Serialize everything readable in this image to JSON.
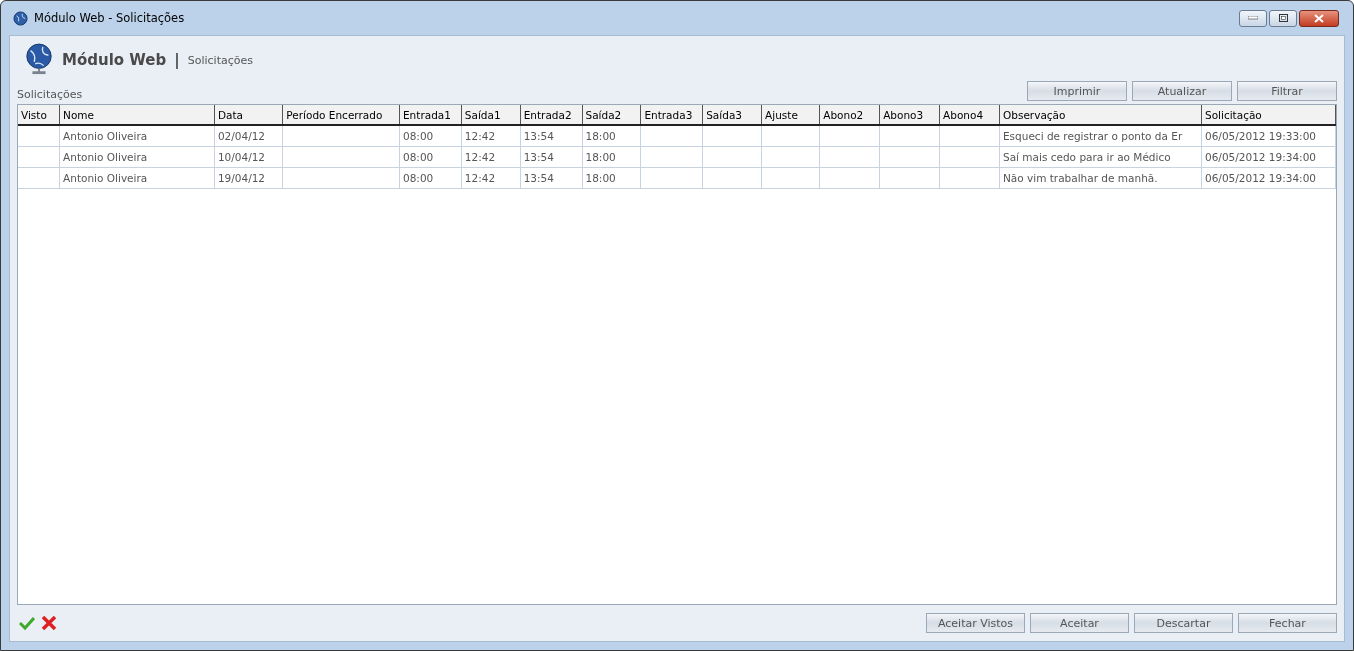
{
  "window": {
    "title": "Módulo Web - Solicitações"
  },
  "header": {
    "title": "Módulo Web",
    "separator": "|",
    "subtitle": "Solicitações"
  },
  "toolbar_buttons": [
    "Imprimir",
    "Atualizar",
    "Filtrar"
  ],
  "table": {
    "label": "Solicitações",
    "columns": [
      "Visto",
      "Nome",
      "Data",
      "Período Encerrado",
      "Entrada1",
      "Saída1",
      "Entrada2",
      "Saída2",
      "Entrada3",
      "Saída3",
      "Ajuste",
      "Abono2",
      "Abono3",
      "Abono4",
      "Observação",
      "Solicitação"
    ],
    "rows": [
      {
        "cells": [
          null,
          "Antonio Oliveira",
          "02/04/12",
          null,
          "08:00",
          "12:42",
          "13:54",
          "18:00",
          null,
          null,
          null,
          null,
          null,
          null,
          "Esqueci de registrar o ponto da Er",
          "06/05/2012 19:33:00"
        ]
      },
      {
        "cells": [
          null,
          "Antonio Oliveira",
          "10/04/12",
          null,
          "08:00",
          "12:42",
          "13:54",
          "18:00",
          null,
          null,
          null,
          null,
          null,
          null,
          "Saí mais cedo para ir ao Médico",
          "06/05/2012 19:34:00"
        ]
      },
      {
        "cells": [
          null,
          "Antonio Oliveira",
          "19/04/12",
          null,
          "08:00",
          "12:42",
          "13:54",
          "18:00",
          null,
          null,
          null,
          null,
          null,
          null,
          "Não vim trabalhar de manhã.",
          "06/05/2012 19:34:00"
        ]
      }
    ]
  },
  "footer_buttons": [
    "Aceitar Vistos",
    "Aceitar",
    "Descartar",
    "Fechar"
  ]
}
